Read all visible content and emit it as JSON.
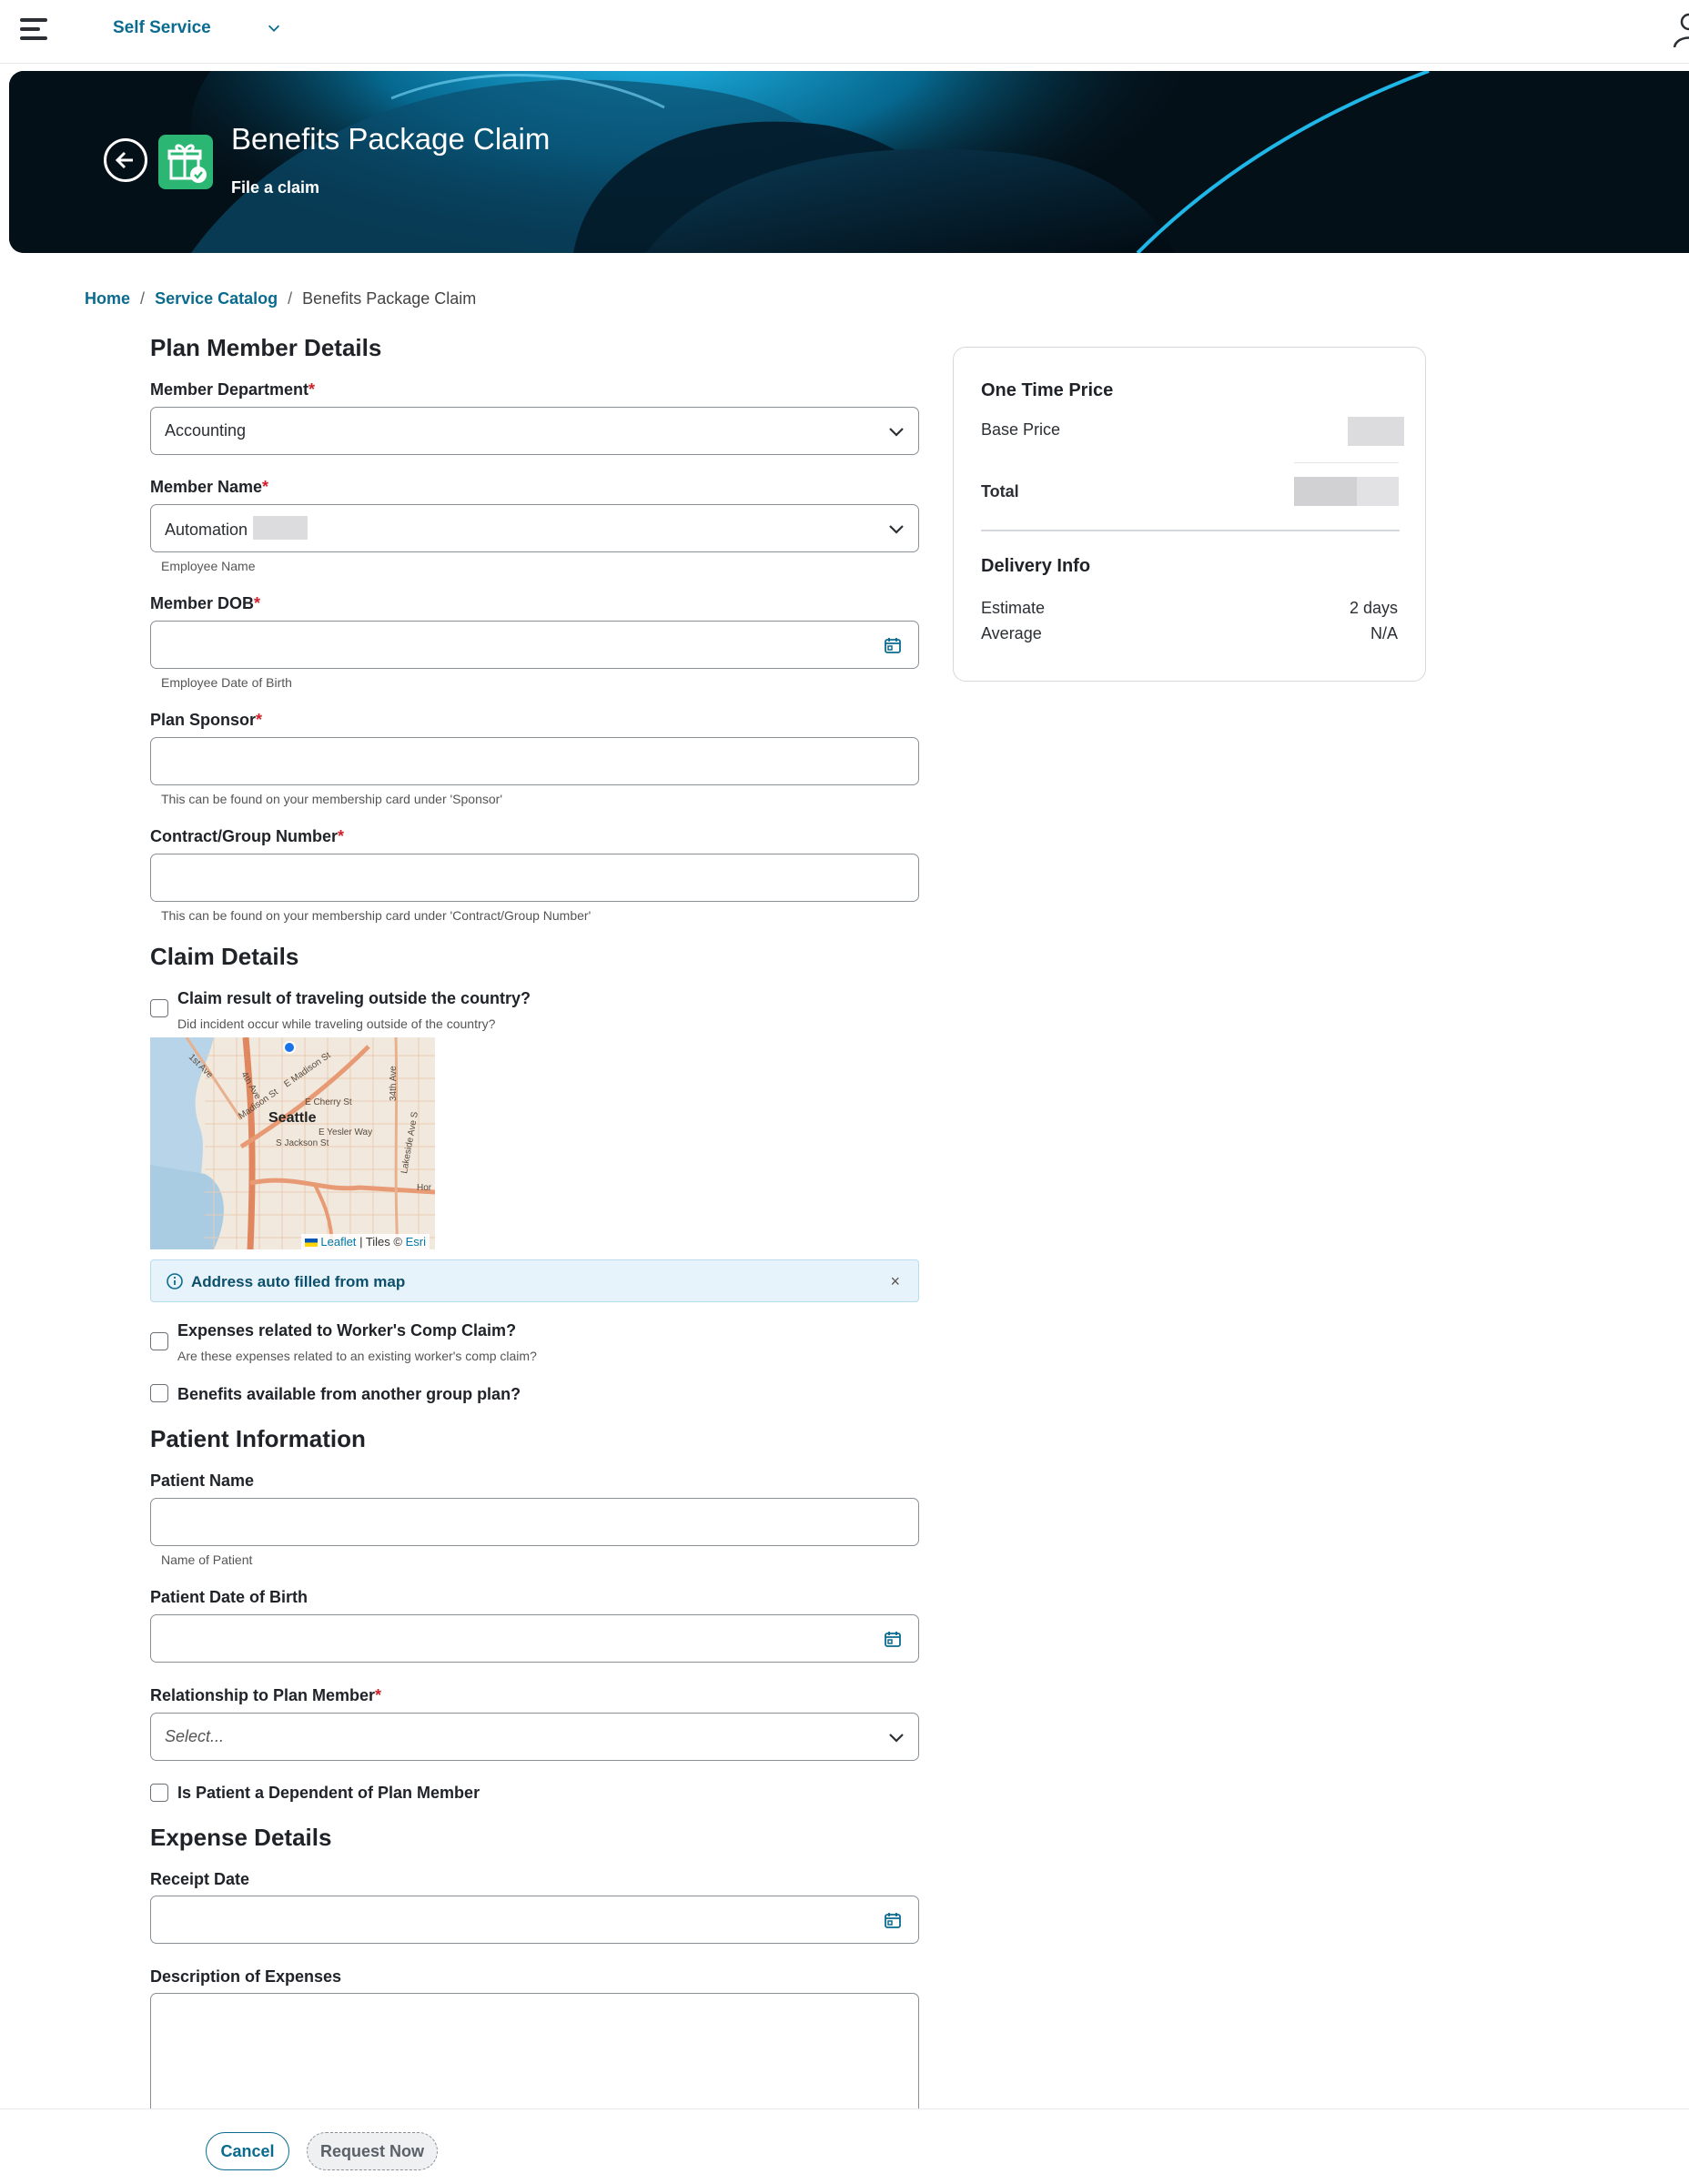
{
  "topbar": {
    "app_name": "Self Service",
    "menu_icon": "hamburger-icon",
    "user_icon": "user-icon"
  },
  "hero": {
    "title": "Benefits Package Claim",
    "subtitle": "File a claim",
    "icon": "gift-check-icon"
  },
  "breadcrumb": {
    "home": "Home",
    "catalog": "Service Catalog",
    "current": "Benefits Package Claim",
    "separator": "/"
  },
  "plan_member": {
    "section_title": "Plan Member Details",
    "department": {
      "label": "Member Department",
      "value": "Accounting"
    },
    "name": {
      "label": "Member Name",
      "value": "Automation",
      "helper": "Employee Name"
    },
    "dob": {
      "label": "Member DOB",
      "helper": "Employee Date of Birth"
    },
    "sponsor": {
      "label": "Plan Sponsor",
      "helper": "This can be found on your membership card under 'Sponsor'"
    },
    "contract": {
      "label": "Contract/Group Number",
      "helper": "This can be found on your membership card under 'Contract/Group Number'"
    }
  },
  "claim": {
    "section_title": "Claim Details",
    "travel": {
      "label": "Claim result of traveling outside the country?",
      "helper": "Did incident occur while traveling outside of the country?"
    },
    "map": {
      "city_label": "Seattle",
      "streets": [
        "E Madison St",
        "Madison St",
        "E Cherry St",
        "E Yesler Way",
        "S Jackson St",
        "34th Ave",
        "4th Ave",
        "1st Ave",
        "Lakeside Ave S",
        "Hor"
      ],
      "attribution_leaflet": "Leaflet",
      "attribution_sep": "| Tiles ©",
      "attribution_esri": "Esri"
    },
    "alert": "Address auto filled from map",
    "alert_close": "×",
    "workers_comp": {
      "label": "Expenses related to Worker's Comp Claim?",
      "helper": "Are these expenses related to an existing worker's comp claim?"
    },
    "other_plan": {
      "label": "Benefits available from another group plan?"
    }
  },
  "patient": {
    "section_title": "Patient Information",
    "name": {
      "label": "Patient Name",
      "helper": "Name of Patient"
    },
    "dob": {
      "label": "Patient Date of Birth"
    },
    "relationship": {
      "label": "Relationship to Plan Member",
      "placeholder": "Select..."
    },
    "dependent": {
      "label": "Is Patient a Dependent of Plan Member"
    }
  },
  "expense": {
    "section_title": "Expense Details",
    "receipt_date": {
      "label": "Receipt Date"
    },
    "description": {
      "label": "Description of Expenses"
    }
  },
  "summary": {
    "price_title": "One Time Price",
    "base_price_label": "Base Price",
    "total_label": "Total",
    "delivery_title": "Delivery Info",
    "estimate_label": "Estimate",
    "estimate_value": "2 days",
    "average_label": "Average",
    "average_value": "N/A"
  },
  "actions": {
    "cancel": "Cancel",
    "request": "Request Now"
  },
  "colors": {
    "accent": "#0b6b8f",
    "required": "#d0212b",
    "hero_icon_bg": "#2bb673"
  }
}
